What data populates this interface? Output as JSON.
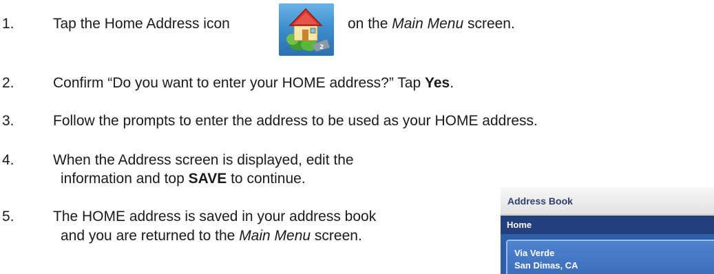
{
  "steps": [
    {
      "num": "1.",
      "a": "Tap the Home Address icon",
      "b": "on the ",
      "c": "Main Menu",
      "d": " screen."
    },
    {
      "num": "2.",
      "a": "Confirm “Do you want to enter your HOME address?”  Tap ",
      "b": "Yes",
      "c": "."
    },
    {
      "num": "3.",
      "a": "Follow the prompts to enter the address to be used as your HOME address."
    },
    {
      "num": "4.",
      "a": "When the Address screen is displayed, edit the",
      "b": "information and top ",
      "c": "SAVE",
      "d": " to continue."
    },
    {
      "num": "5.",
      "a": "The HOME address is saved in your address book",
      "b": "and you are returned to the ",
      "c": "Main Menu",
      "d": " screen."
    }
  ],
  "address_book": {
    "title": "Address Book",
    "bar": "Home",
    "line1": "Via Verde",
    "line2": "San Dimas, CA"
  },
  "icons": {
    "home": "home-address-icon"
  }
}
